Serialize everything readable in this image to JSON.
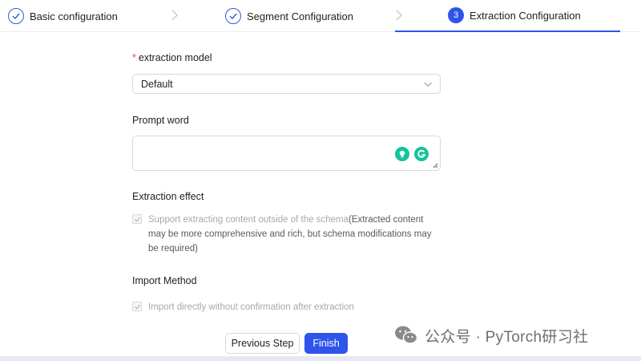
{
  "steps": [
    {
      "label": "Basic configuration",
      "state": "done"
    },
    {
      "label": "Segment Configuration",
      "state": "done"
    },
    {
      "label": "Extraction Configuration",
      "state": "active",
      "number": "3"
    }
  ],
  "form": {
    "extraction_model": {
      "label": "extraction model",
      "required_mark": "*",
      "value": "Default"
    },
    "prompt_word": {
      "label": "Prompt word",
      "value": ""
    },
    "extraction_effect": {
      "label": "Extraction effect",
      "checkbox_text_main": "Support extracting content outside of the schema",
      "checkbox_text_extra": "(Extracted content may be more comprehensive and rich, but schema modifications may be required)",
      "checked": true,
      "disabled": true
    },
    "import_method": {
      "label": "Import Method",
      "checkbox_text": "Import directly without confirmation after extraction",
      "checked": true,
      "disabled": true
    }
  },
  "buttons": {
    "previous": "Previous Step",
    "finish": "Finish"
  },
  "watermark": {
    "text": "公众号 · PyTorch研习社"
  },
  "colors": {
    "primary": "#2f54eb",
    "required": "#e5484d",
    "grammarly": "#15c39a"
  }
}
